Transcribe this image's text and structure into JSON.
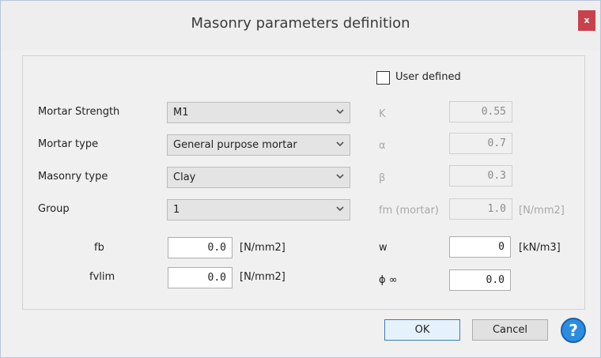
{
  "window": {
    "title": "Masonry parameters definition",
    "close_label": "x"
  },
  "user_defined": {
    "label": "User defined",
    "checked": false
  },
  "left_fields": [
    {
      "label": "Mortar Strength",
      "value": "M1"
    },
    {
      "label": "Mortar type",
      "value": "General purpose mortar"
    },
    {
      "label": "Masonry type",
      "value": "Clay"
    },
    {
      "label": "Group",
      "value": "1"
    }
  ],
  "fb": {
    "label": "fb",
    "value": "0.0",
    "unit": "[N/mm2]"
  },
  "fvlim": {
    "label": "fvlim",
    "value": "0.0",
    "unit": "[N/mm2]"
  },
  "right_fields": {
    "k": {
      "label": "K",
      "value": "0.55"
    },
    "alpha": {
      "label": "α",
      "value": "0.7"
    },
    "beta": {
      "label": "β",
      "value": "0.3"
    },
    "fm": {
      "label": "fm (mortar)",
      "value": "1.0",
      "unit": "[N/mm2]"
    },
    "w": {
      "label": "w",
      "value": "0",
      "unit": "[kN/m3]"
    },
    "phi": {
      "label": "ϕ ∞",
      "value": "0.0"
    }
  },
  "buttons": {
    "ok": "OK",
    "cancel": "Cancel",
    "help": "?"
  },
  "colors": {
    "close_bg": "#c8414b",
    "help_bg": "#2b8de0",
    "ok_border": "#3c7fb1"
  }
}
